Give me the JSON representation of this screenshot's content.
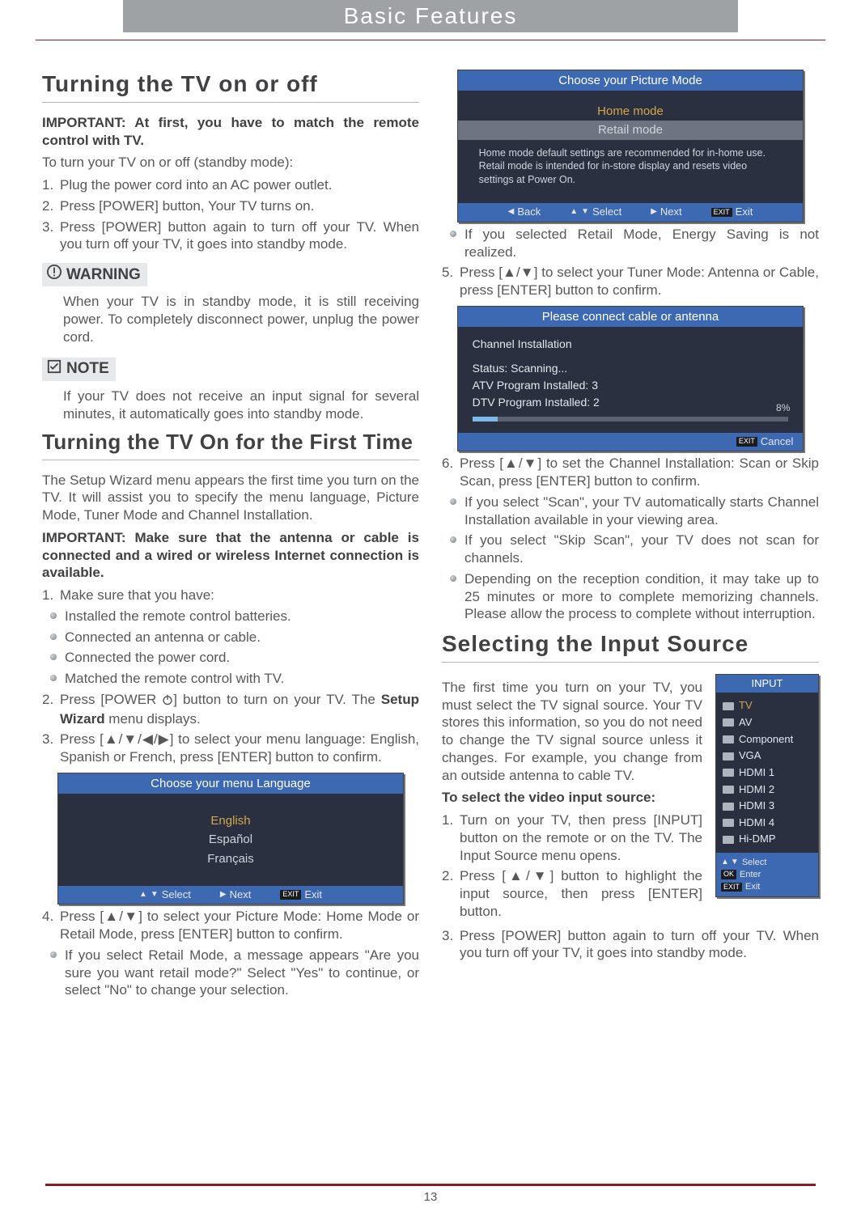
{
  "banner": {
    "title": "Basic Features"
  },
  "page_number": "13",
  "left": {
    "h_turn_onoff": "Turning the TV on or off",
    "important1": "IMPORTANT: At first, you have to match the remote control with TV.",
    "intro": "To turn your TV on or off (standby mode):",
    "steps_on": [
      "Plug the power cord into an AC power outlet.",
      "Press [POWER] button, Your TV turns on.",
      "Press [POWER] button again to turn off your TV. When you turn off your TV, it goes into standby mode."
    ],
    "warn_label": "WARNING",
    "warn_body": "When your TV is in standby mode, it is still receiving power. To completely disconnect power, unplug the power cord.",
    "note_label": "NOTE",
    "note_body": "If your TV does not receive an input signal for several minutes, it automatically goes into standby mode.",
    "h_first_time": "Turning the TV On for the First Time",
    "first_intro": "The Setup Wizard menu appears the first time you turn on the TV. It will assist you to specify the menu language, Picture Mode, Tuner Mode and Channel Installation.",
    "important2": "IMPORTANT: Make sure that the antenna or cable is connected and a wired or wireless Internet connection is available.",
    "step1_lead": "Make sure that you have:",
    "step1_items": [
      "Installed the remote control batteries.",
      "Connected an antenna or cable.",
      "Connected the power cord.",
      "Matched the remote control with TV."
    ],
    "step2a": "Press [POWER ",
    "step2b": "] button to turn on your TV. The ",
    "step2c": "Setup Wizard",
    "step2d": " menu displays.",
    "step3": "Press [▲/▼/◀/▶] to select your menu language: English, Spanish or French, press [ENTER] button to confirm.",
    "osd_lang": {
      "title": "Choose your menu Language",
      "opts": [
        "English",
        "Español",
        "Français"
      ],
      "foot_select": "Select",
      "foot_next": "Next",
      "foot_exit": "Exit",
      "exit_key": "EXIT"
    },
    "step4": "Press [▲/▼] to select your Picture Mode: Home Mode or Retail Mode, press [ENTER] button to confirm.",
    "step4_note": "If you select Retail Mode, a message appears \"Are you sure you want retail mode?\" Select \"Yes\" to continue, or select \"No\" to change your selection."
  },
  "right": {
    "osd_pic": {
      "title": "Choose your Picture Mode",
      "opt_home": "Home mode",
      "opt_retail": "Retail mode",
      "note": "Home mode default settings are recommended for in-home use. Retail mode is intended for in-store display and resets video settings at Power On.",
      "foot_back": "Back",
      "foot_select": "Select",
      "foot_next": "Next",
      "foot_exit": "Exit",
      "exit_key": "EXIT"
    },
    "pic_bullet": "If you selected Retail Mode, Energy Saving is not realized.",
    "step5": "Press [▲/▼] to select your Tuner Mode: Antenna or Cable, press [ENTER] button to confirm.",
    "osd_scan": {
      "title": "Please connect cable or antenna",
      "line1": "Channel Installation",
      "line2": "Status: Scanning...",
      "line3": "ATV Program Installed: 3",
      "line4": "DTV Program Installed: 2",
      "pct": "8%",
      "foot_cancel": "Cancel",
      "exit_key": "EXIT"
    },
    "step6": "Press [▲/▼] to set the Channel Installation: Scan or Skip Scan, press [ENTER] button to confirm.",
    "scan_bullets": [
      "If you select \"Scan\", your TV automatically starts Channel Installation available in your viewing area.",
      "If you select \"Skip Scan\", your TV does not scan for channels.",
      "Depending on the reception condition, it may take up to 25 minutes or more to complete memorizing channels. Please allow the process to complete without interruption."
    ],
    "h_input": "Selecting the Input Source",
    "input_intro": "The first time you turn on your TV, you must select the TV signal source. Your TV stores this information, so you do not need to change the TV signal source unless it changes. For example, you change from an outside antenna to cable TV.",
    "input_select_hd": "To select the video input source:",
    "input_steps": [
      "Turn on your TV, then press [INPUT] button on the remote or on the TV. The Input Source menu opens.",
      "Press [▲/▼] button to highlight the input source, then press [ENTER] button.",
      "Press [POWER] button again to turn off your TV. When you turn off your TV, it goes into standby mode."
    ],
    "input_osd": {
      "title": "INPUT",
      "items": [
        "TV",
        "AV",
        "Component",
        "VGA",
        "HDMI 1",
        "HDMI 2",
        "HDMI 3",
        "HDMI 4",
        "Hi-DMP"
      ],
      "leg_select": "Select",
      "leg_enter": "Enter",
      "leg_exit": "Exit",
      "ok_key": "OK",
      "exit_key": "EXIT"
    }
  }
}
